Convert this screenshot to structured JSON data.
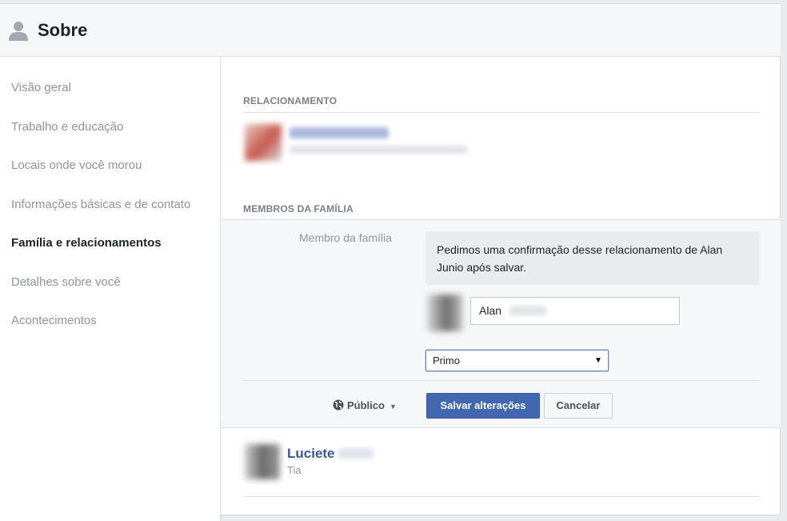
{
  "header": {
    "title": "Sobre",
    "icon": "person-silhouette-icon"
  },
  "sidebar": {
    "items": [
      {
        "label": "Visão geral",
        "active": false
      },
      {
        "label": "Trabalho e educação",
        "active": false
      },
      {
        "label": "Locais onde você morou",
        "active": false
      },
      {
        "label": "Informações básicas e de contato",
        "active": false
      },
      {
        "label": "Família e relacionamentos",
        "active": true
      },
      {
        "label": "Detalhes sobre você",
        "active": false
      },
      {
        "label": "Acontecimentos",
        "active": false
      }
    ]
  },
  "relationship": {
    "section_title": "RELACIONAMENTO"
  },
  "family": {
    "section_title": "MEMBROS DA FAMÍLIA",
    "field_label": "Membro da família",
    "notice": "Pedimos uma confirmação desse relacionamento de Alan Junio após salvar.",
    "name_value": "Alan",
    "relation_selected": "Primo",
    "privacy_label": "Público",
    "save_label": "Salvar alterações",
    "cancel_label": "Cancelar"
  },
  "member": {
    "name": "Luciete",
    "relation": "Tia"
  },
  "colors": {
    "accent": "#4267b2",
    "link": "#365899",
    "muted_text": "#90949c",
    "page_bg": "#e9ebee"
  }
}
